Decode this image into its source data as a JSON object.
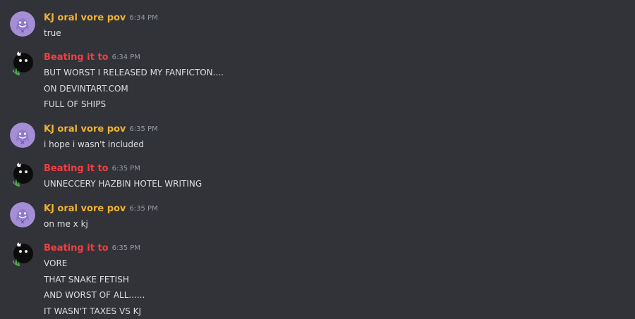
{
  "users": {
    "kj": {
      "name": "KJ oral vore pov",
      "color": "#f0b232",
      "avatar_icon": "purple-ghost-avatar-icon"
    },
    "beating": {
      "name": "Beating it to",
      "color": "#f23f43",
      "avatar_icon": "black-ball-avatar-icon"
    }
  },
  "messages": [
    {
      "author": "KJ oral vore pov",
      "time": "6:34 PM",
      "lines": [
        "true"
      ]
    },
    {
      "author": "Beating it to",
      "time": "6:34 PM",
      "lines": [
        "BUT WORST I RELEASED MY FANFICTON....",
        "ON DEVINTART.COM",
        "FULL OF SHIPS"
      ]
    },
    {
      "author": "KJ oral vore pov",
      "time": "6:35 PM",
      "lines": [
        "i hope i wasn't included"
      ]
    },
    {
      "author": "Beating it to",
      "time": "6:35 PM",
      "lines": [
        "UNNECCERY HAZBIN HOTEL WRITING"
      ]
    },
    {
      "author": "KJ oral vore pov",
      "time": "6:35 PM",
      "lines": [
        "on me x kj"
      ]
    },
    {
      "author": "Beating it to",
      "time": "6:35 PM",
      "lines": [
        "VORE",
        "THAT SNAKE FETISH",
        "AND WORST OF ALL......",
        "IT WASN'T TAXES VS KJ"
      ]
    }
  ]
}
